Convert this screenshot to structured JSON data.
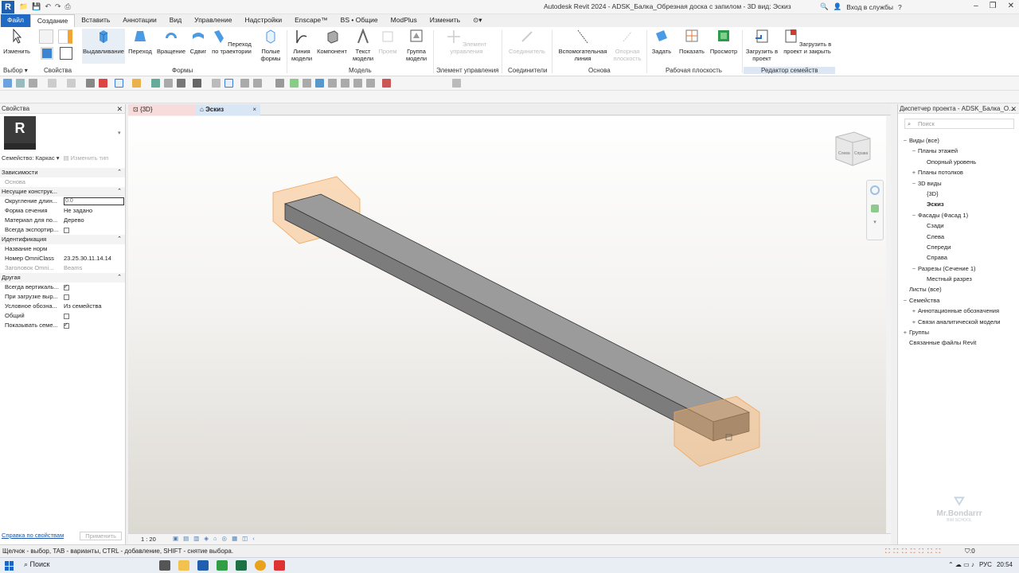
{
  "app": {
    "logo_letter": "R",
    "window_title": "Autodesk Revit 2024 - ADSK_Балка_Обрезная доска с запилом - 3D вид: Эскиз",
    "login": "Вход в службы",
    "help": "?"
  },
  "tabs": [
    "Файл",
    "Создание",
    "Вставить",
    "Аннотации",
    "Вид",
    "Управление",
    "Надстройки",
    "Enscape™",
    "BS • Общие",
    "ModPlus",
    "Изменить"
  ],
  "ribbon": {
    "buttons": {
      "modify": "Изменить",
      "extrusion": "Выдавливание",
      "blend": "Переход",
      "revolve": "Вращение",
      "sweep": "Сдвиг",
      "swept_blend": "Переход по траектории",
      "void_forms": "Полые формы",
      "model_line": "Линия модели",
      "component": "Компонент",
      "model_text": "Текст модели",
      "opening": "Проем",
      "model_group": "Группа модели",
      "control": "Элемент управления",
      "connector": "Соединитель",
      "ref_line": "Вспомогательная линия",
      "ref_plane": "Опорная плоскость",
      "set": "Задать",
      "show": "Показать",
      "viewer": "Просмотр",
      "load_into_project": "Загрузить в проект",
      "load_and_close": "Загрузить в проект и закрыть"
    },
    "panels": {
      "select": "Выбор",
      "properties": "Свойства",
      "forms": "Формы",
      "model": "Модель",
      "control": "Элемент управления",
      "connectors": "Соединители",
      "datum": "Основа",
      "work_plane": "Рабочая плоскость",
      "family_editor": "Редактор семейств"
    }
  },
  "properties": {
    "title": "Свойства",
    "family": "Семейство: Каркас",
    "edit_type": "Изменить тип",
    "groups": [
      {
        "name": "Зависимости",
        "rows": [
          {
            "name": "Основа",
            "value": "",
            "muted": true
          }
        ]
      },
      {
        "name": "Несущие конструк...",
        "rows": [
          {
            "name": "Округление длин...",
            "value": "0.0",
            "edit": true
          },
          {
            "name": "Форма сечения",
            "value": "Не задано"
          },
          {
            "name": "Материал для по...",
            "value": "Дерево"
          },
          {
            "name": "Всегда экспортир...",
            "check": false
          }
        ]
      },
      {
        "name": "Идентификация",
        "rows": [
          {
            "name": "Название норм",
            "value": ""
          },
          {
            "name": "Номер OmniClass",
            "value": "23.25.30.11.14.14"
          },
          {
            "name": "Заголовок Omni...",
            "value": "Beams",
            "muted": true
          }
        ]
      },
      {
        "name": "Другая",
        "rows": [
          {
            "name": "Всегда вертикаль...",
            "check": true
          },
          {
            "name": "При загрузке выр...",
            "check": false
          },
          {
            "name": "Условное обозна...",
            "value": "Из семейства"
          },
          {
            "name": "Общий",
            "check": false
          },
          {
            "name": "Показывать семе...",
            "check": true
          }
        ]
      }
    ],
    "help_link": "Справка по свойствам",
    "apply": "Применить"
  },
  "view_tabs": [
    {
      "label": "{3D}",
      "close": "×"
    },
    {
      "label": "Эскиз",
      "close": "×"
    }
  ],
  "viewcube": {
    "left": "Слева",
    "right": "Справа"
  },
  "view_status": {
    "scale": "1 : 20"
  },
  "browser": {
    "title": "Диспетчер проекта - ADSK_Балка_О...",
    "search_placeholder": "Поиск",
    "nodes": [
      {
        "label": "Виды (все)",
        "level": 0,
        "toggle": "−"
      },
      {
        "label": "Планы этажей",
        "level": 1,
        "toggle": "−"
      },
      {
        "label": "Опорный уровень",
        "level": 2,
        "toggle": ""
      },
      {
        "label": "Планы потолков",
        "level": 1,
        "toggle": "+"
      },
      {
        "label": "3D виды",
        "level": 1,
        "toggle": "−"
      },
      {
        "label": "{3D}",
        "level": 2,
        "toggle": ""
      },
      {
        "label": "Эскиз",
        "level": 2,
        "toggle": "",
        "bold": true
      },
      {
        "label": "Фасады (Фасад 1)",
        "level": 1,
        "toggle": "−"
      },
      {
        "label": "Сзади",
        "level": 2,
        "toggle": ""
      },
      {
        "label": "Слева",
        "level": 2,
        "toggle": ""
      },
      {
        "label": "Спереди",
        "level": 2,
        "toggle": ""
      },
      {
        "label": "Справа",
        "level": 2,
        "toggle": ""
      },
      {
        "label": "Разрезы (Сечение 1)",
        "level": 1,
        "toggle": "−"
      },
      {
        "label": "Местный разрез",
        "level": 2,
        "toggle": ""
      },
      {
        "label": "Листы (все)",
        "level": 0,
        "toggle": ""
      },
      {
        "label": "Семейства",
        "level": 0,
        "toggle": "−"
      },
      {
        "label": "Аннотационные обозначения",
        "level": 1,
        "toggle": "+"
      },
      {
        "label": "Связи аналитической модели",
        "level": 1,
        "toggle": "+"
      },
      {
        "label": "Группы",
        "level": 0,
        "toggle": "+"
      },
      {
        "label": "Связанные файлы Revit",
        "level": 0,
        "toggle": ""
      }
    ]
  },
  "watermark": {
    "name": "Mr.Bondarrr",
    "sub": "BIM SCHOOL"
  },
  "status": "Щелчок - выбор, TAB - варианты, CTRL - добавление, SHIFT - снятие выбора.",
  "status_right": ":0",
  "taskbar": {
    "search": "Поиск",
    "lang": "РУС",
    "time": "20:54"
  },
  "colors": {
    "file_tab": "#1f6ac4",
    "beam": "#8a8a8a",
    "end_box": "#f7b26a"
  }
}
